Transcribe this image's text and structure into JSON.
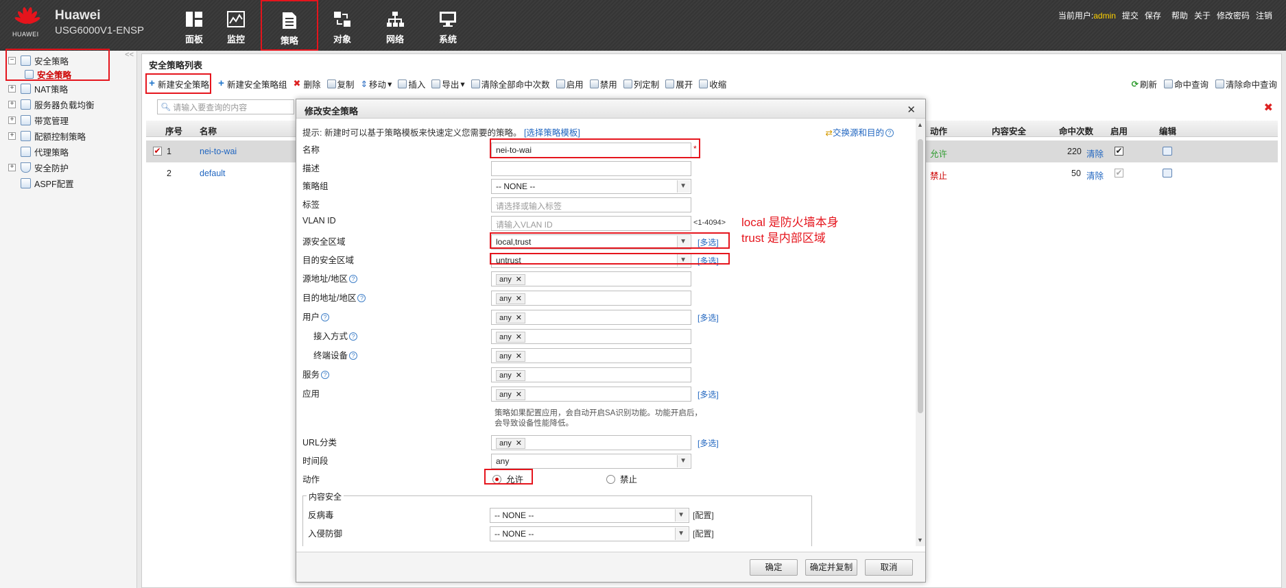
{
  "brand": {
    "vendor": "HUAWEI",
    "name": "Huawei",
    "model": "USG6000V1-ENSP"
  },
  "nav": [
    {
      "label": "面板",
      "icon": "dashboard-icon"
    },
    {
      "label": "监控",
      "icon": "monitor-icon"
    },
    {
      "label": "策略",
      "icon": "policy-icon",
      "active": true
    },
    {
      "label": "对象",
      "icon": "object-icon"
    },
    {
      "label": "网络",
      "icon": "network-icon"
    },
    {
      "label": "系统",
      "icon": "system-icon"
    }
  ],
  "top_right": {
    "user_prefix": "当前用户:",
    "user": "admin",
    "links": [
      "提交",
      "保存",
      "帮助",
      "关于",
      "修改密码",
      "注销"
    ]
  },
  "sidebar": {
    "collapse": "<<",
    "items": [
      {
        "label": "安全策略",
        "expanded": true
      },
      {
        "label": "安全策略",
        "child": true,
        "selected": true
      },
      {
        "label": "NAT策略"
      },
      {
        "label": "服务器负载均衡"
      },
      {
        "label": "带宽管理"
      },
      {
        "label": "配额控制策略"
      },
      {
        "label": "代理策略"
      },
      {
        "label": "安全防护"
      },
      {
        "label": "ASPF配置"
      }
    ]
  },
  "main": {
    "title": "安全策略列表",
    "toolbar": [
      "新建安全策略",
      "新建安全策略组",
      "删除",
      "复制",
      "移动",
      "插入",
      "导出",
      "清除全部命中次数",
      "启用",
      "禁用",
      "列定制",
      "展开",
      "收缩"
    ],
    "toolbar_right": [
      "刷新",
      "命中查询",
      "清除命中查询"
    ],
    "search_placeholder": "请输入要查询的内容",
    "columns": [
      "序号",
      "名称",
      "动作",
      "内容安全",
      "命中次数",
      "启用",
      "编辑"
    ],
    "rows": [
      {
        "no": "1",
        "name": "nei-to-wai",
        "action": "允许",
        "hits": "220",
        "clear": "清除",
        "selected": true
      },
      {
        "no": "2",
        "name": "default",
        "action": "禁止",
        "hits": "50",
        "clear": "清除"
      }
    ]
  },
  "dialog": {
    "title": "修改安全策略",
    "hint": "提示: 新建时可以基于策略模板来快速定义您需要的策略。",
    "hint_link": "[选择策略模板]",
    "swap": "交换源和目的",
    "fields": {
      "name": {
        "label": "名称",
        "value": "nei-to-wai",
        "required": "*"
      },
      "desc": {
        "label": "描述",
        "value": ""
      },
      "group": {
        "label": "策略组",
        "value": "-- NONE --"
      },
      "tag": {
        "label": "标签",
        "placeholder": "请选择或输入标签"
      },
      "vlan": {
        "label": "VLAN ID",
        "placeholder": "请输入VLAN ID",
        "range": "<1-4094>"
      },
      "src_zone": {
        "label": "源安全区域",
        "value": "local,trust",
        "multi": "[多选]"
      },
      "dst_zone": {
        "label": "目的安全区域",
        "value": "untrust",
        "multi": "[多选]"
      },
      "src_addr": {
        "label": "源地址/地区",
        "value": "any"
      },
      "dst_addr": {
        "label": "目的地址/地区",
        "value": "any"
      },
      "user": {
        "label": "用户",
        "value": "any",
        "multi": "[多选]"
      },
      "access": {
        "label": "接入方式",
        "value": "any"
      },
      "terminal": {
        "label": "终端设备",
        "value": "any"
      },
      "service": {
        "label": "服务",
        "value": "any"
      },
      "app": {
        "label": "应用",
        "value": "any",
        "multi": "[多选]"
      },
      "app_note": "策略如果配置应用，会自动开启SA识别功能。功能开启后，会导致设备性能降低。",
      "url": {
        "label": "URL分类",
        "value": "any",
        "multi": "[多选]"
      },
      "time": {
        "label": "时间段",
        "value": "any"
      },
      "action": {
        "label": "动作",
        "allow": "允许",
        "deny": "禁止",
        "selected": "allow"
      }
    },
    "content_security": {
      "legend": "内容安全",
      "antivirus": {
        "label": "反病毒",
        "value": "-- NONE --",
        "config": "[配置]"
      },
      "ips": {
        "label": "入侵防御",
        "value": "-- NONE --",
        "config": "[配置]"
      }
    },
    "buttons": {
      "ok": "确定",
      "ok_copy": "确定并复制",
      "cancel": "取消"
    }
  },
  "annotation": {
    "line1": "local 是防火墙本身",
    "line2": "trust 是内部区域"
  },
  "colors": {
    "highlight": "#e5141c",
    "link": "#2166c0",
    "allow": "#2d9b2d",
    "deny": "#c00000"
  }
}
